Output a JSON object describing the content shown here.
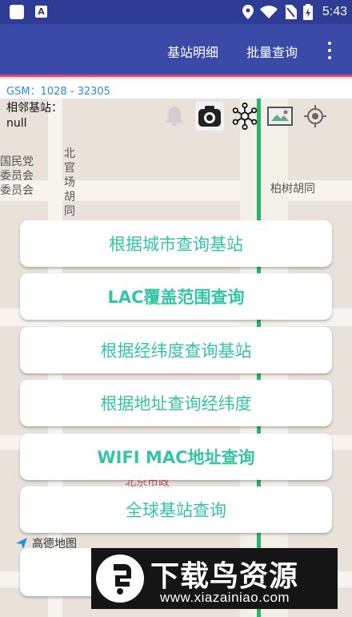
{
  "status_bar": {
    "time": "5:43",
    "a_badge": "A"
  },
  "app_bar": {
    "action_1": "基站明细",
    "action_2": "批量查询"
  },
  "info": {
    "gsm": "GSM：1028 - 32305",
    "neighbor_label": "相邻基站：",
    "neighbor_value": "null"
  },
  "map_labels": {
    "street_1": "北官场胡同",
    "street_2": "柏树胡同",
    "street_3": "国民党委员会委员会",
    "street_4": "北京市政",
    "brand": "高德地图"
  },
  "menu": {
    "items": [
      {
        "label": "根据城市查询基站",
        "bold": false
      },
      {
        "label": "LAC覆盖范围查询",
        "bold": true
      },
      {
        "label": "根据经纬度查询基站",
        "bold": false
      },
      {
        "label": "根据地址查询经纬度",
        "bold": false
      },
      {
        "label": "WIFI MAC地址查询",
        "bold": true
      },
      {
        "label": "全球基站查询",
        "bold": false
      }
    ]
  },
  "watermark": {
    "title": "下载鸟资源",
    "url": "www.xiazainiao.com"
  },
  "colors": {
    "app_bar": "#3a4aa8",
    "accent": "#e0467c",
    "menu_text": "#36c4a6",
    "gsm_text": "#2a8ed8"
  }
}
